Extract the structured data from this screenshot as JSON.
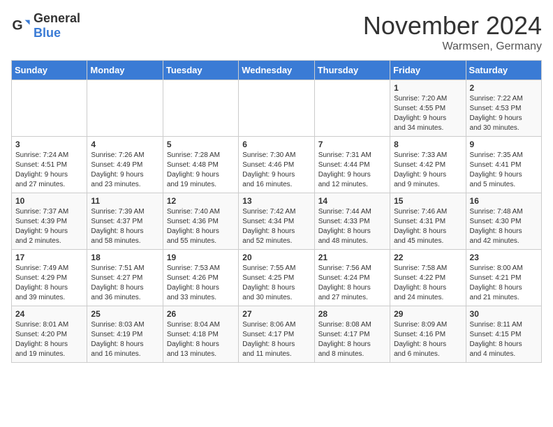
{
  "header": {
    "logo_general": "General",
    "logo_blue": "Blue",
    "month_title": "November 2024",
    "location": "Warmsen, Germany"
  },
  "weekdays": [
    "Sunday",
    "Monday",
    "Tuesday",
    "Wednesday",
    "Thursday",
    "Friday",
    "Saturday"
  ],
  "weeks": [
    [
      {
        "day": "",
        "info": ""
      },
      {
        "day": "",
        "info": ""
      },
      {
        "day": "",
        "info": ""
      },
      {
        "day": "",
        "info": ""
      },
      {
        "day": "",
        "info": ""
      },
      {
        "day": "1",
        "info": "Sunrise: 7:20 AM\nSunset: 4:55 PM\nDaylight: 9 hours\nand 34 minutes."
      },
      {
        "day": "2",
        "info": "Sunrise: 7:22 AM\nSunset: 4:53 PM\nDaylight: 9 hours\nand 30 minutes."
      }
    ],
    [
      {
        "day": "3",
        "info": "Sunrise: 7:24 AM\nSunset: 4:51 PM\nDaylight: 9 hours\nand 27 minutes."
      },
      {
        "day": "4",
        "info": "Sunrise: 7:26 AM\nSunset: 4:49 PM\nDaylight: 9 hours\nand 23 minutes."
      },
      {
        "day": "5",
        "info": "Sunrise: 7:28 AM\nSunset: 4:48 PM\nDaylight: 9 hours\nand 19 minutes."
      },
      {
        "day": "6",
        "info": "Sunrise: 7:30 AM\nSunset: 4:46 PM\nDaylight: 9 hours\nand 16 minutes."
      },
      {
        "day": "7",
        "info": "Sunrise: 7:31 AM\nSunset: 4:44 PM\nDaylight: 9 hours\nand 12 minutes."
      },
      {
        "day": "8",
        "info": "Sunrise: 7:33 AM\nSunset: 4:42 PM\nDaylight: 9 hours\nand 9 minutes."
      },
      {
        "day": "9",
        "info": "Sunrise: 7:35 AM\nSunset: 4:41 PM\nDaylight: 9 hours\nand 5 minutes."
      }
    ],
    [
      {
        "day": "10",
        "info": "Sunrise: 7:37 AM\nSunset: 4:39 PM\nDaylight: 9 hours\nand 2 minutes."
      },
      {
        "day": "11",
        "info": "Sunrise: 7:39 AM\nSunset: 4:37 PM\nDaylight: 8 hours\nand 58 minutes."
      },
      {
        "day": "12",
        "info": "Sunrise: 7:40 AM\nSunset: 4:36 PM\nDaylight: 8 hours\nand 55 minutes."
      },
      {
        "day": "13",
        "info": "Sunrise: 7:42 AM\nSunset: 4:34 PM\nDaylight: 8 hours\nand 52 minutes."
      },
      {
        "day": "14",
        "info": "Sunrise: 7:44 AM\nSunset: 4:33 PM\nDaylight: 8 hours\nand 48 minutes."
      },
      {
        "day": "15",
        "info": "Sunrise: 7:46 AM\nSunset: 4:31 PM\nDaylight: 8 hours\nand 45 minutes."
      },
      {
        "day": "16",
        "info": "Sunrise: 7:48 AM\nSunset: 4:30 PM\nDaylight: 8 hours\nand 42 minutes."
      }
    ],
    [
      {
        "day": "17",
        "info": "Sunrise: 7:49 AM\nSunset: 4:29 PM\nDaylight: 8 hours\nand 39 minutes."
      },
      {
        "day": "18",
        "info": "Sunrise: 7:51 AM\nSunset: 4:27 PM\nDaylight: 8 hours\nand 36 minutes."
      },
      {
        "day": "19",
        "info": "Sunrise: 7:53 AM\nSunset: 4:26 PM\nDaylight: 8 hours\nand 33 minutes."
      },
      {
        "day": "20",
        "info": "Sunrise: 7:55 AM\nSunset: 4:25 PM\nDaylight: 8 hours\nand 30 minutes."
      },
      {
        "day": "21",
        "info": "Sunrise: 7:56 AM\nSunset: 4:24 PM\nDaylight: 8 hours\nand 27 minutes."
      },
      {
        "day": "22",
        "info": "Sunrise: 7:58 AM\nSunset: 4:22 PM\nDaylight: 8 hours\nand 24 minutes."
      },
      {
        "day": "23",
        "info": "Sunrise: 8:00 AM\nSunset: 4:21 PM\nDaylight: 8 hours\nand 21 minutes."
      }
    ],
    [
      {
        "day": "24",
        "info": "Sunrise: 8:01 AM\nSunset: 4:20 PM\nDaylight: 8 hours\nand 19 minutes."
      },
      {
        "day": "25",
        "info": "Sunrise: 8:03 AM\nSunset: 4:19 PM\nDaylight: 8 hours\nand 16 minutes."
      },
      {
        "day": "26",
        "info": "Sunrise: 8:04 AM\nSunset: 4:18 PM\nDaylight: 8 hours\nand 13 minutes."
      },
      {
        "day": "27",
        "info": "Sunrise: 8:06 AM\nSunset: 4:17 PM\nDaylight: 8 hours\nand 11 minutes."
      },
      {
        "day": "28",
        "info": "Sunrise: 8:08 AM\nSunset: 4:17 PM\nDaylight: 8 hours\nand 8 minutes."
      },
      {
        "day": "29",
        "info": "Sunrise: 8:09 AM\nSunset: 4:16 PM\nDaylight: 8 hours\nand 6 minutes."
      },
      {
        "day": "30",
        "info": "Sunrise: 8:11 AM\nSunset: 4:15 PM\nDaylight: 8 hours\nand 4 minutes."
      }
    ]
  ]
}
